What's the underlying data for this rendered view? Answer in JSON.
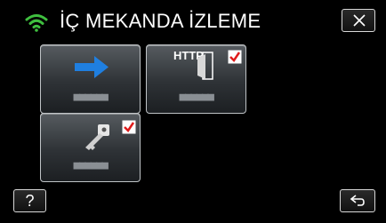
{
  "header": {
    "title": "İÇ MEKANDA İZLEME",
    "status_icon": "wifi-icon",
    "close_icon": "close-icon"
  },
  "tiles": [
    {
      "icon": "arrow-right-icon",
      "label": "■■■■■■",
      "checked": false
    },
    {
      "icon": "http-door-icon",
      "icon_text": "HTTP",
      "label": "■■■■■■",
      "checked": true
    },
    {
      "icon": "key-icon",
      "label": "■■■■■■",
      "checked": true
    }
  ],
  "footer": {
    "help_label": "?",
    "back_icon": "return-icon"
  },
  "colors": {
    "accent_green": "#3fbf3f",
    "arrow_blue": "#1f7fe0",
    "check_red": "#e01c1c",
    "background": "#000000"
  }
}
